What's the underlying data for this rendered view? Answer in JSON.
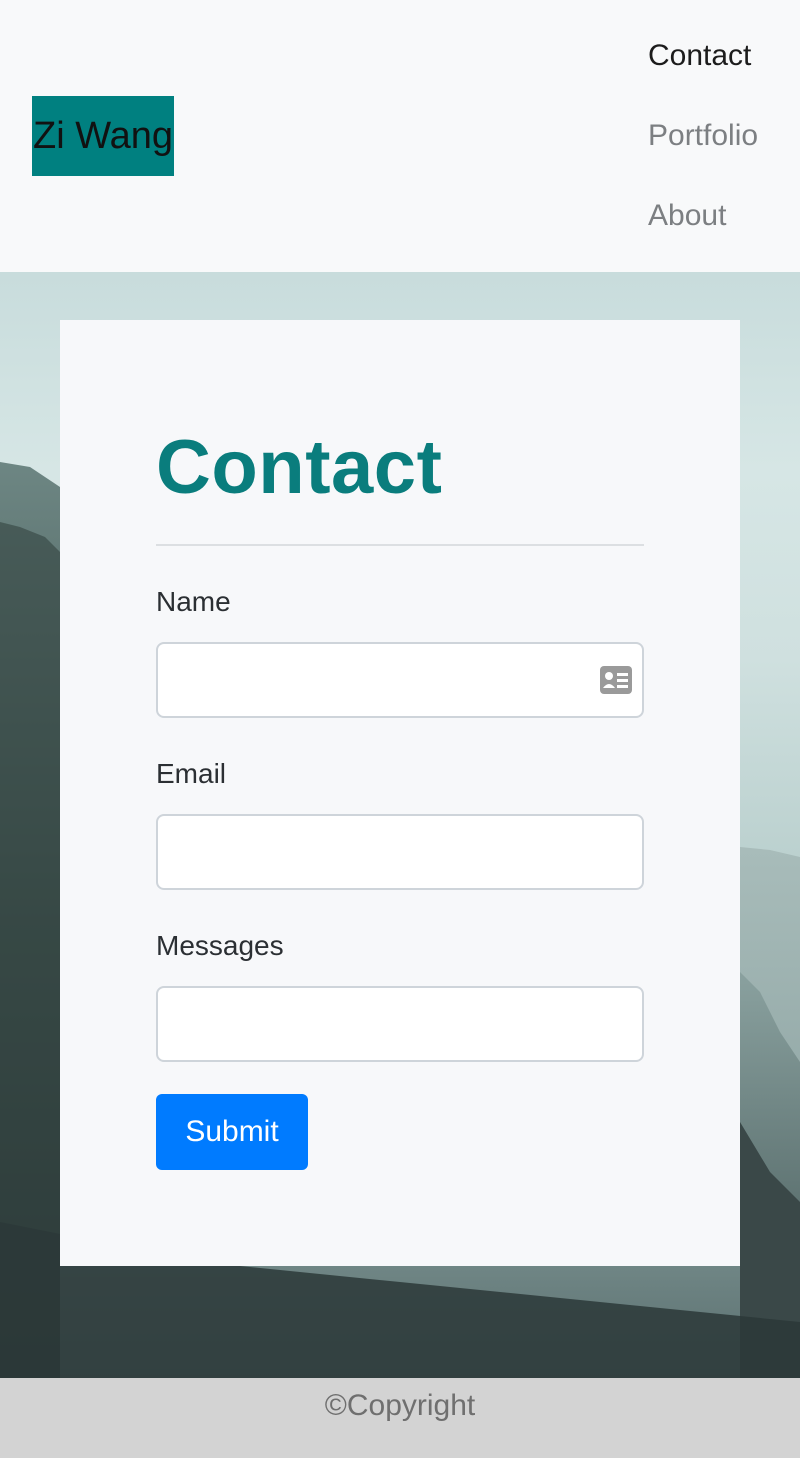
{
  "navbar": {
    "brand": "Zi Wang",
    "items": [
      {
        "label": "Contact"
      },
      {
        "label": "Portfolio"
      },
      {
        "label": "About"
      }
    ]
  },
  "contact": {
    "title": "Contact",
    "fields": {
      "name": {
        "label": "Name",
        "value": ""
      },
      "email": {
        "label": "Email",
        "value": ""
      },
      "messages": {
        "label": "Messages",
        "value": ""
      }
    },
    "submit_label": "Submit"
  },
  "footer": {
    "copyright": "©Copyright"
  },
  "colors": {
    "brand_bg": "#008080",
    "title": "#0a7d7d",
    "primary_button": "#007bff",
    "footer_bg": "#d3d3d3"
  },
  "icons": {
    "name_field": "contact-card-icon"
  }
}
